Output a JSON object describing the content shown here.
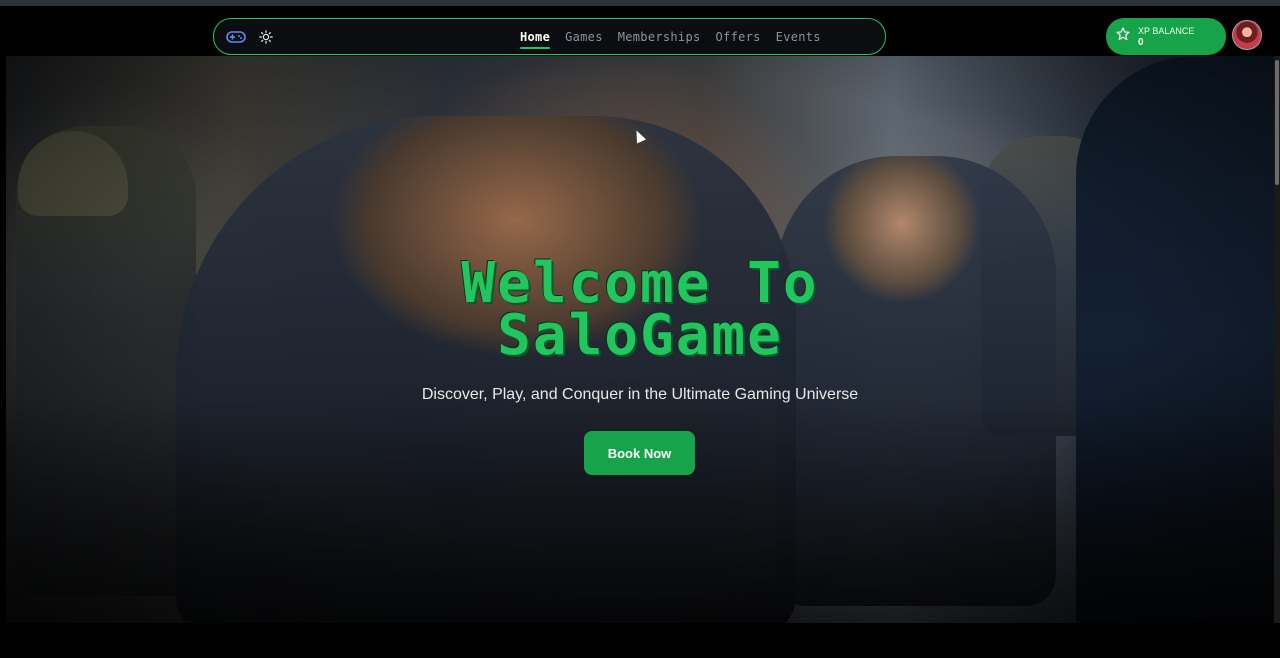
{
  "nav": {
    "icons": [
      "gamepad-icon",
      "theme-toggle-sun-icon"
    ],
    "links": [
      {
        "label": "Home",
        "active": true
      },
      {
        "label": "Games",
        "active": false
      },
      {
        "label": "Memberships",
        "active": false
      },
      {
        "label": "Offers",
        "active": false
      },
      {
        "label": "Events",
        "active": false
      }
    ]
  },
  "xp": {
    "icon": "star-icon",
    "label": "XP BALANCE",
    "value": "0"
  },
  "hero": {
    "title_line1": "Welcome To",
    "title_line2": "SaloGame",
    "subtitle": "Discover, Play, and Conquer in the Ultimate Gaming Universe",
    "cta": "Book Now"
  },
  "colors": {
    "accent": "#22c55e",
    "button": "#16a34a",
    "nav_inactive": "#8b949e",
    "background": "#000000"
  }
}
